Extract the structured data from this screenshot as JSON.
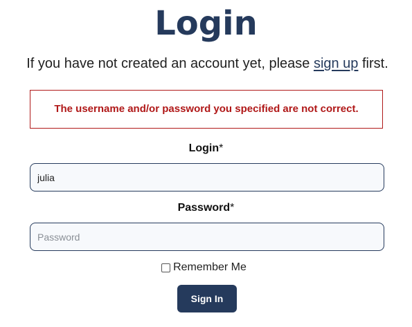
{
  "page": {
    "title": "Login"
  },
  "intro": {
    "before": "If you have not created an account yet, please ",
    "link": "sign up",
    "after": " first."
  },
  "alert": {
    "message": "The username and/or password you specified are not correct.",
    "color": "#b01818"
  },
  "form": {
    "login_label": "Login",
    "login_value": "julia",
    "password_label": "Password",
    "password_placeholder": "Password",
    "password_value": "",
    "required_marker": "*",
    "remember_label": "Remember Me",
    "remember_checked": false,
    "submit_label": "Sign In"
  },
  "theme": {
    "accent": "#253a5c"
  }
}
